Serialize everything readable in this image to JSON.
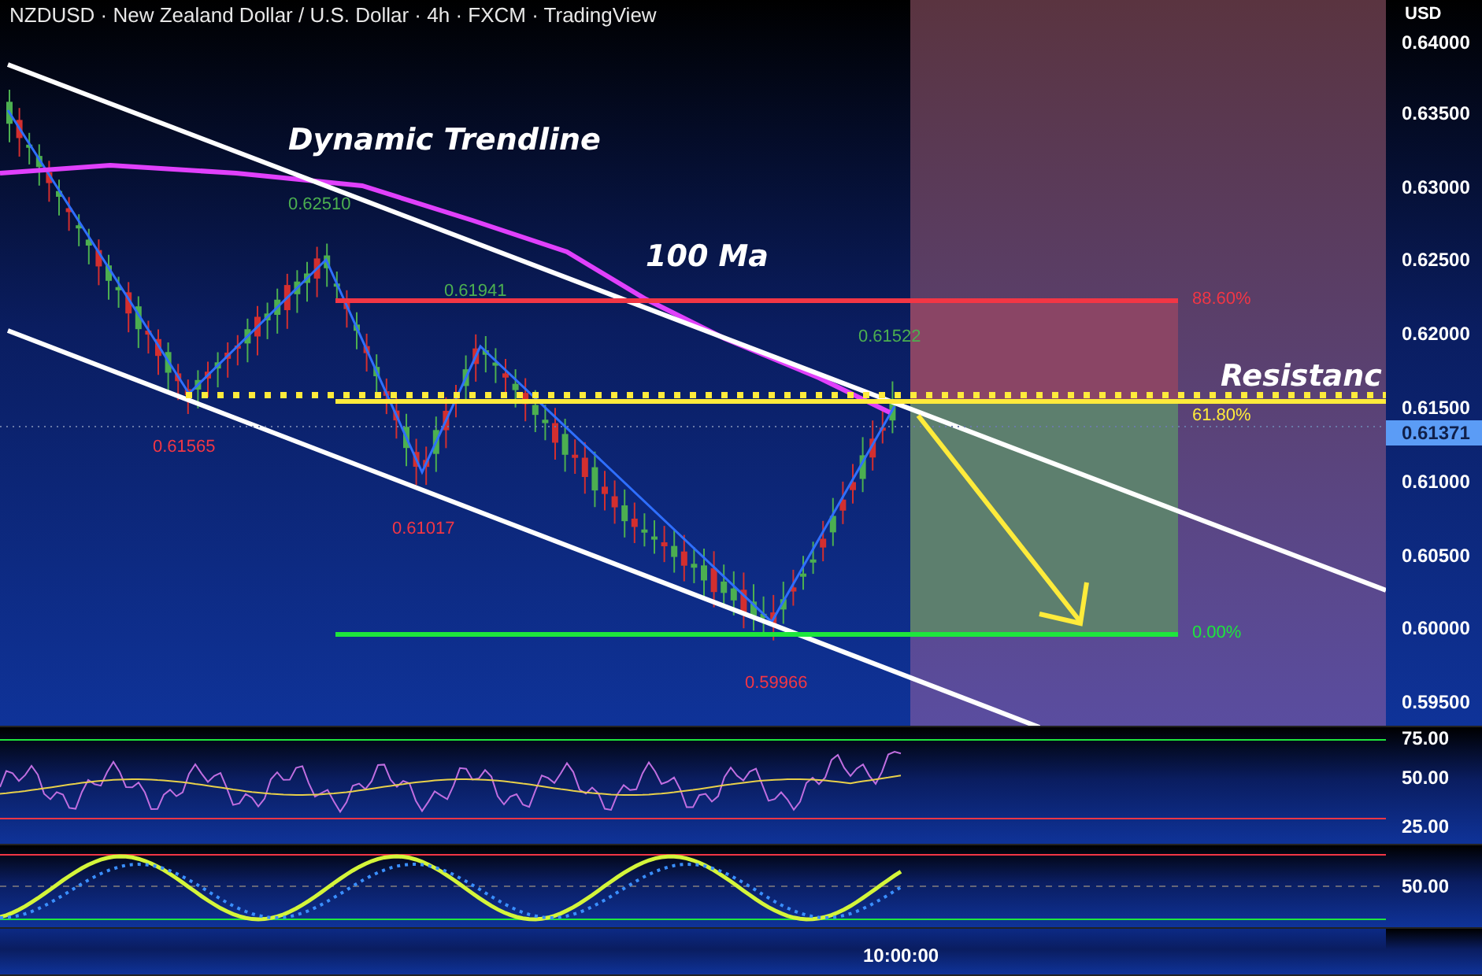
{
  "header": {
    "title": "NZDUSD · New Zealand Dollar / U.S. Dollar · 4h · FXCM · TradingView"
  },
  "annotations": [
    {
      "text": "Dynamic Trendline"
    },
    {
      "text": "100 Ma"
    },
    {
      "text": "Resistanc"
    }
  ],
  "pivot_labels": [
    {
      "text": "0.62510",
      "color": "#4caf50"
    },
    {
      "text": "0.61941",
      "color": "#4caf50"
    },
    {
      "text": "0.61522",
      "color": "#4caf50"
    },
    {
      "text": "0.61565",
      "color": "#f23645"
    },
    {
      "text": "0.61017",
      "color": "#f23645"
    },
    {
      "text": "0.59966",
      "color": "#f23645"
    }
  ],
  "fib_levels": [
    {
      "label": "88.60%",
      "color": "#f23645"
    },
    {
      "label": "61.80%",
      "color": "#ffeb3b"
    },
    {
      "label": "0.00%",
      "color": "#1ee63c"
    }
  ],
  "price_axis": {
    "unit": "USD",
    "ticks": [
      "0.64000",
      "0.63500",
      "0.63000",
      "0.62500",
      "0.62000",
      "0.61500",
      "0.61000",
      "0.60500",
      "0.60000",
      "0.59500"
    ],
    "last_price": "0.61371"
  },
  "rsi_pane": {
    "ticks": [
      "75.00",
      "50.00",
      "25.00"
    ]
  },
  "stoch_pane": {
    "ticks": [
      "50.00"
    ]
  },
  "time_axis": {
    "label": "10:00:00"
  }
}
